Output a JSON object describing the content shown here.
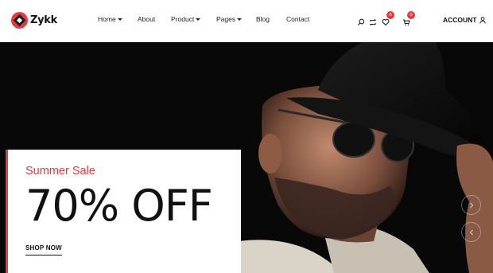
{
  "brand": {
    "name": "Zykk",
    "accent": "#e8393f"
  },
  "nav": {
    "items": [
      {
        "label": "Home",
        "has_dropdown": true
      },
      {
        "label": "About",
        "has_dropdown": false
      },
      {
        "label": "Product",
        "has_dropdown": true
      },
      {
        "label": "Pages",
        "has_dropdown": true
      },
      {
        "label": "Blog",
        "has_dropdown": false
      },
      {
        "label": "Contact",
        "has_dropdown": false
      }
    ]
  },
  "toolbar": {
    "search_icon": "search-icon",
    "compare_icon": "compare-icon",
    "wishlist_icon": "heart-icon",
    "wishlist_count": "0",
    "cart_icon": "cart-icon",
    "cart_count": "0",
    "account_label": "ACCOUNT",
    "account_icon": "user-icon"
  },
  "hero": {
    "subtitle": "Summer Sale",
    "title": "70% OFF",
    "cta_label": "SHOP NOW",
    "prev_icon": "chevron-right-icon",
    "next_icon": "chevron-left-icon"
  }
}
